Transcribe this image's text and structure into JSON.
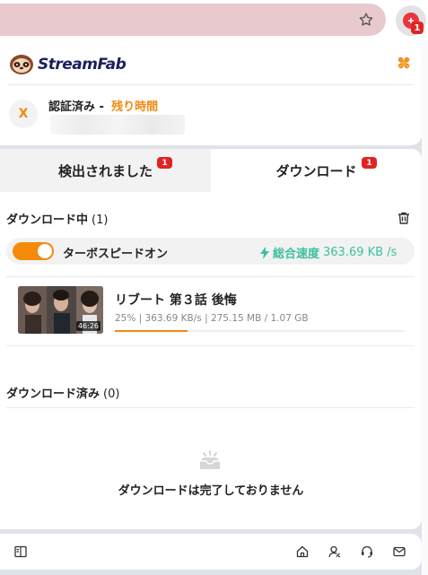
{
  "browser": {
    "star_icon": "star-icon",
    "extension_icon": "streamfab-extension-icon",
    "extension_badge": "1"
  },
  "header": {
    "brand": "StreamFab",
    "menu_icon": "grid-icon"
  },
  "account": {
    "avatar_letter": "X",
    "auth_label": "認証済み -",
    "remaining_label": "残り時間"
  },
  "tabs": [
    {
      "label": "検出されました",
      "badge": "1"
    },
    {
      "label": "ダウンロード",
      "badge": "1"
    }
  ],
  "downloading": {
    "title": "ダウンロード中",
    "count": "(1)",
    "turbo_label": "ターボスピードオン",
    "turbo_on": true,
    "speed_label": "総合速度",
    "speed_value": "363.69 KB /s",
    "items": [
      {
        "title": "リブート 第３話 後悔",
        "duration": "46:26",
        "stats": "25% | 363.69 KB/s | 275.15 MB / 1.07 GB",
        "progress_percent": 25
      }
    ]
  },
  "downloaded": {
    "title": "ダウンロード済み",
    "count": "(0)",
    "empty_message": "ダウンロードは完了しておりません"
  },
  "footer": {
    "icons": [
      "sidebar-icon",
      "home-icon",
      "user-icon",
      "support-icon",
      "mail-icon"
    ]
  },
  "colors": {
    "accent": "#f08a10",
    "speed": "#3cc0a0",
    "badge": "#e02424",
    "brand": "#1a1f5c"
  }
}
